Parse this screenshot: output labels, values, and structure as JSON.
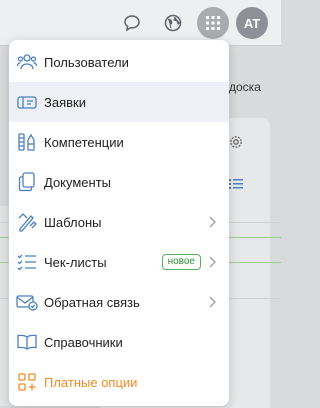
{
  "header": {
    "avatar_initials": "AT",
    "icons": [
      "chat-icon",
      "globe-icon",
      "apps-grid-icon"
    ]
  },
  "background": {
    "board_label": "доска"
  },
  "menu": {
    "items": [
      {
        "label": "Пользователи",
        "icon": "users-icon"
      },
      {
        "label": "Заявки",
        "icon": "ticket-icon",
        "active": true
      },
      {
        "label": "Компетенции",
        "icon": "competencies-icon"
      },
      {
        "label": "Документы",
        "icon": "documents-icon"
      },
      {
        "label": "Шаблоны",
        "icon": "templates-icon",
        "has_submenu": true
      },
      {
        "label": "Чек-листы",
        "icon": "checklist-icon",
        "has_submenu": true,
        "badge": "новое"
      },
      {
        "label": "Обратная связь",
        "icon": "feedback-icon",
        "has_submenu": true
      },
      {
        "label": "Справочники",
        "icon": "book-icon"
      },
      {
        "label": "Платные опции",
        "icon": "paid-options-icon",
        "accent": true
      }
    ]
  },
  "colors": {
    "icon_blue": "#4a7fc1",
    "accent_orange": "#f08a24",
    "badge_green": "#2f8f3a",
    "active_bg": "#eef0f6"
  }
}
